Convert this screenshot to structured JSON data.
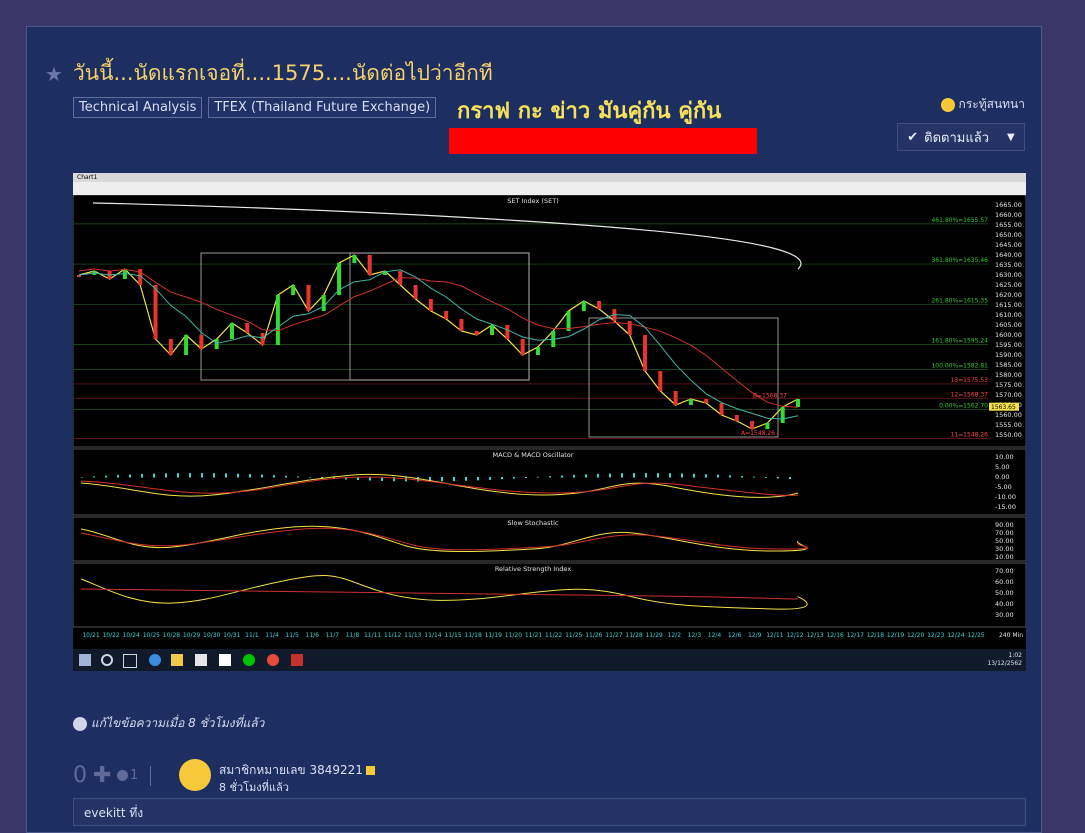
{
  "post": {
    "title": "วันนี้...นัดแรกเจอที่....1575....นัดต่อไปว่าอีกที",
    "tags": [
      "Technical Analysis",
      "TFEX (Thailand Future Exchange)"
    ],
    "overlay_title": "กราฟ กะ ข่าว มันคู่กัน คู่กัน",
    "forum_label": "กระทู้สนทนา",
    "follow_label": "ติดตามแล้ว",
    "edit_note": "แก้ไขข้อความเมื่อ 8 ชั่วโมงที่แล้ว",
    "vote_count": "0",
    "emoji_count": "1",
    "member_label": "สมาชิกหมายเลข 3849221",
    "member_time": "8 ชั่วโมงที่แล้ว",
    "comment_preview": "evekitt ทึ่ง"
  },
  "screenshot": {
    "window_title": "Chart1",
    "taskbar_time": "1:02",
    "taskbar_date": "13/12/2562",
    "timeframe": "240 Min",
    "panels": {
      "price": "SET Index (SET)",
      "macd": "MACD & MACD Oscillator",
      "stoch": "Slow Stochastic",
      "rsi": "Relative Strength Index"
    },
    "price_axis": [
      "1665.00",
      "1660.00",
      "1655.00",
      "1650.00",
      "1645.00",
      "1640.00",
      "1635.00",
      "1630.00",
      "1625.00",
      "1620.00",
      "1615.00",
      "1610.00",
      "1605.00",
      "1600.00",
      "1595.00",
      "1590.00",
      "1585.00",
      "1580.00",
      "1575.00",
      "1570.00",
      "1565.00",
      "1560.00",
      "1555.00",
      "1550.00"
    ],
    "macd_axis": [
      "10.00",
      "5.00",
      "0.00",
      "-5.00",
      "-10.00",
      "-15.00"
    ],
    "stoch_axis": [
      "90.00",
      "70.00",
      "50.00",
      "30.00",
      "10.00"
    ],
    "rsi_axis": [
      "70.00",
      "60.00",
      "50.00",
      "40.00",
      "30.00"
    ],
    "fib_labels": [
      "461.80%=1655.57",
      "361.80%=1635.46",
      "261.80%=1615.35",
      "161.80%=1595.24",
      "100.00%=1582.81",
      "13=1575.53",
      "12=1568.37",
      "0.00%=1562.70",
      "11=1548.26"
    ],
    "marker_labels": [
      "B=1568.37",
      "A=1548.26"
    ],
    "last_price": "1563.65",
    "dates": [
      "10/21",
      "10/22",
      "10/24",
      "10/25",
      "10/28",
      "10/29",
      "10/30",
      "10/31",
      "11/1",
      "11/4",
      "11/5",
      "11/6",
      "11/7",
      "11/8",
      "11/11",
      "11/12",
      "11/13",
      "11/14",
      "11/15",
      "11/18",
      "11/19",
      "11/20",
      "11/21",
      "11/22",
      "11/25",
      "11/26",
      "11/27",
      "11/28",
      "11/29",
      "12/2",
      "12/3",
      "12/4",
      "12/6",
      "12/9",
      "12/11",
      "12/12",
      "12/13",
      "12/16",
      "12/17",
      "12/18",
      "12/19",
      "12/20",
      "12/23",
      "12/24",
      "12/25"
    ]
  }
}
